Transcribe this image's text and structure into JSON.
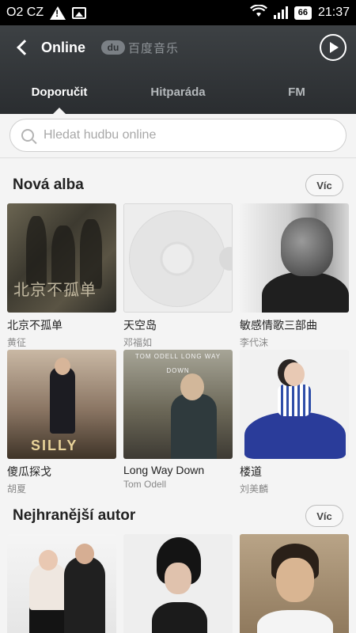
{
  "status_bar": {
    "carrier": "O2 CZ",
    "battery": "66",
    "time": "21:37"
  },
  "header": {
    "title": "Online",
    "brand_logo": "du",
    "brand_name": "百度音乐"
  },
  "tabs": [
    {
      "label": "Doporučit",
      "active": true
    },
    {
      "label": "Hitparáda",
      "active": false
    },
    {
      "label": "FM",
      "active": false
    }
  ],
  "search": {
    "placeholder": "Hledat hudbu online",
    "value": ""
  },
  "new_albums": {
    "title": "Nová alba",
    "more_label": "Víc",
    "items": [
      {
        "title": "北京不孤单",
        "artist": "黄征",
        "cover_text": "北京不孤单"
      },
      {
        "title": "天空岛",
        "artist": "邓福如"
      },
      {
        "title": "敏感情歌三部曲",
        "artist": "李代沫"
      },
      {
        "title": "傻瓜探戈",
        "artist": "胡夏",
        "cover_text": "SILLY"
      },
      {
        "title": "Long Way Down",
        "artist": "Tom Odell",
        "cover_text": "TOM ODELL  LONG WAY DOWN"
      },
      {
        "title": "楼道",
        "artist": "刘美麟"
      }
    ]
  },
  "top_artists": {
    "title": "Nejhranější autor",
    "more_label": "Víc"
  },
  "colors": {
    "header_bg": "#33373a",
    "page_bg": "#f4f4f4",
    "status_bg": "#000000"
  }
}
